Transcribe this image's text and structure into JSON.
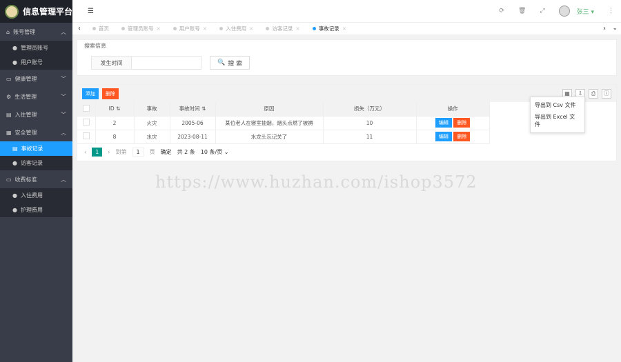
{
  "app": {
    "title": "信息管理平台",
    "user": "张三",
    "watermark": "https://www.huzhan.com/ishop3572"
  },
  "sidebar": [
    {
      "label": "账号管理",
      "icon": "home-icon",
      "expanded": true,
      "items": [
        {
          "label": "管理员账号"
        },
        {
          "label": "用户账号"
        }
      ]
    },
    {
      "label": "健康管理",
      "icon": "card-icon"
    },
    {
      "label": "生活管理",
      "icon": "gears-icon"
    },
    {
      "label": "入住管理",
      "icon": "file-icon"
    },
    {
      "label": "安全管理",
      "icon": "calendar-icon",
      "expanded": true,
      "items": [
        {
          "label": "事故记录",
          "active": true
        },
        {
          "label": "访客记录"
        }
      ]
    },
    {
      "label": "收费标准",
      "icon": "ticket-icon",
      "expanded": true,
      "items": [
        {
          "label": "入住费用"
        },
        {
          "label": "护理费用"
        }
      ]
    }
  ],
  "tabs": [
    {
      "label": "首页"
    },
    {
      "label": "管理员账号"
    },
    {
      "label": "用户账号"
    },
    {
      "label": "入住费用"
    },
    {
      "label": "访客记录"
    },
    {
      "label": "事故记录",
      "active": true
    }
  ],
  "search": {
    "legend": "搜索信息",
    "field_label": "发生时间",
    "value": "",
    "button": "搜 索"
  },
  "toolbar": {
    "add": "添加",
    "delete": "删除"
  },
  "export_menu": [
    "导出到 Csv 文件",
    "导出到 Excel 文件"
  ],
  "table": {
    "headers": [
      "ID",
      "事故",
      "事故时间",
      "原因",
      "损失（万元）",
      "操作"
    ],
    "rows": [
      [
        "2",
        "火灾",
        "2005-06",
        "某位老人在寝室抽烟，烟头点燃了被褥",
        "10"
      ],
      [
        "8",
        "水灾",
        "2023-08-11",
        "水龙头忘记关了",
        "11"
      ]
    ],
    "edit": "编辑",
    "del": "删除"
  },
  "pager": {
    "current": "1",
    "goto": "到第",
    "page_input": "1",
    "page_unit": "页",
    "confirm": "确定",
    "total": "共 2 条",
    "size": "10 条/页"
  },
  "colors": {
    "sidebar": "#393d49",
    "active": "#1e9fff",
    "danger": "#ff5722",
    "page": "#009688",
    "user": "#5fb878"
  }
}
